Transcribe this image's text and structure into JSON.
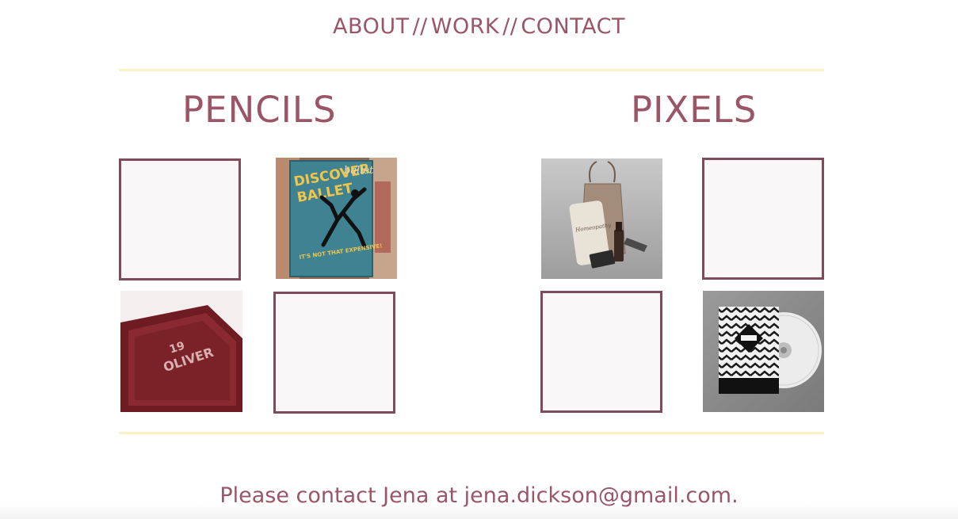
{
  "nav": {
    "items": [
      {
        "label": "ABOUT"
      },
      {
        "label": "WORK"
      },
      {
        "label": "CONTACT"
      }
    ],
    "separator": "//"
  },
  "sections": {
    "pencils": {
      "title": "PENCILS"
    },
    "pixels": {
      "title": "PIXELS"
    }
  },
  "images": {
    "discover_ballet": {
      "line1": "DISCOVER",
      "line2": "BALLET",
      "script": "ballet",
      "tagline": "IT'S NOT THAT EXPENSIVE!"
    },
    "homeopathy": {
      "label": "Homeopathy"
    },
    "oliver_box": {
      "line1": "19",
      "line2": "OLIVER"
    }
  },
  "footer": {
    "text": "Please contact Jena at jena.dickson@gmail.com."
  },
  "colors": {
    "accent": "#9a5566",
    "tile_border": "#7f4a5a",
    "rule": "#f8f3c6"
  }
}
